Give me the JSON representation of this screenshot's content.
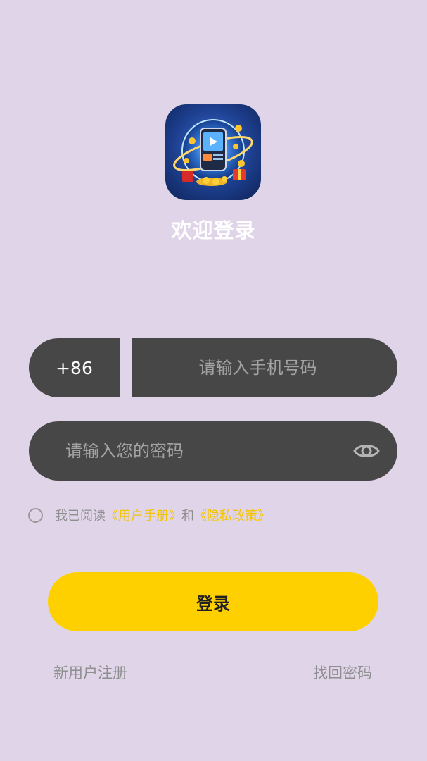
{
  "app": {
    "welcome_title": "欢迎登录"
  },
  "form": {
    "country_code": "+86",
    "phone_placeholder": "请输入手机号码",
    "phone_value": "",
    "password_placeholder": "请输入您的密码",
    "password_value": "",
    "password_toggle_icon": "eye-icon"
  },
  "agreement": {
    "prefix": "我已阅读",
    "user_manual": "《用户手册》",
    "conjunction": "和",
    "privacy_policy": "《隐私政策》",
    "checked": false
  },
  "actions": {
    "login_label": "登录",
    "register_label": "新用户注册",
    "forgot_label": "找回密码"
  },
  "colors": {
    "background": "#e0d5e8",
    "input_bg": "#474747",
    "accent": "#ffd000",
    "link": "#f5c400"
  }
}
